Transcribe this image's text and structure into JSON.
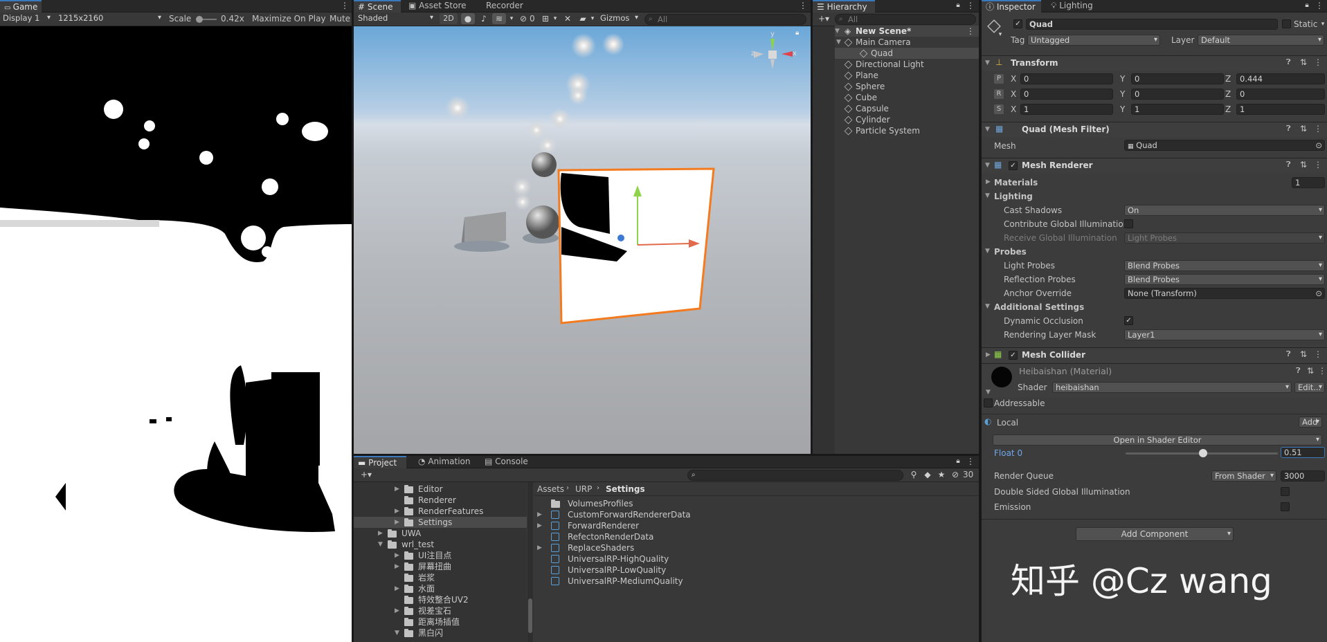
{
  "game": {
    "tab": "Game",
    "display": "Display 1",
    "resolution": "1215x2160",
    "scale_label": "Scale",
    "scale_value": "0.42x",
    "maximize": "Maximize On Play",
    "mute": "Mute A"
  },
  "scene": {
    "tabs": [
      "Scene",
      "Asset Store",
      "Recorder"
    ],
    "shading": "Shaded",
    "mode_2d": "2D",
    "hidden_count": "0",
    "gizmos": "Gizmos",
    "search_placeholder": "All",
    "gizmo_y": "y",
    "gizmo_x": "x",
    "gizmo_z": "z"
  },
  "hierarchy": {
    "tab": "Hierarchy",
    "search_placeholder": "All",
    "scene_name": "New Scene*",
    "items": [
      {
        "label": "Main Camera",
        "level": 1,
        "expanded": true
      },
      {
        "label": "Quad",
        "level": 2,
        "selected": true
      },
      {
        "label": "Directional Light",
        "level": 1
      },
      {
        "label": "Plane",
        "level": 1
      },
      {
        "label": "Sphere",
        "level": 1
      },
      {
        "label": "Cube",
        "level": 1
      },
      {
        "label": "Capsule",
        "level": 1
      },
      {
        "label": "Cylinder",
        "level": 1
      },
      {
        "label": "Particle System",
        "level": 1
      }
    ]
  },
  "inspector": {
    "tabs": [
      "Inspector",
      "Lighting"
    ],
    "object_name": "Quad",
    "static_label": "Static",
    "tag_label": "Tag",
    "tag_value": "Untagged",
    "layer_label": "Layer",
    "layer_value": "Default",
    "transform": {
      "title": "Transform",
      "rows": [
        {
          "key": "P",
          "x": "0",
          "y": "0",
          "z": "0.444"
        },
        {
          "key": "R",
          "x": "0",
          "y": "0",
          "z": "0"
        },
        {
          "key": "S",
          "x": "1",
          "y": "1",
          "z": "1"
        }
      ],
      "axis_x": "X",
      "axis_y": "Y",
      "axis_z": "Z"
    },
    "mesh_filter": {
      "title": "Quad (Mesh Filter)",
      "mesh_label": "Mesh",
      "mesh_value": "Quad"
    },
    "mesh_renderer": {
      "title": "Mesh Renderer",
      "materials_label": "Materials",
      "materials_count": "1",
      "lighting_label": "Lighting",
      "cast_shadows_label": "Cast Shadows",
      "cast_shadows_value": "On",
      "contribute_gi_label": "Contribute Global Illumination",
      "receive_gi_label": "Receive Global Illumination",
      "receive_gi_value": "Light Probes",
      "probes_label": "Probes",
      "light_probes_label": "Light Probes",
      "light_probes_value": "Blend Probes",
      "reflection_probes_label": "Reflection Probes",
      "reflection_probes_value": "Blend Probes",
      "anchor_override_label": "Anchor Override",
      "anchor_override_value": "None (Transform)",
      "additional_label": "Additional Settings",
      "dynamic_occlusion_label": "Dynamic Occlusion",
      "rendering_layer_label": "Rendering Layer Mask",
      "rendering_layer_value": "Layer1"
    },
    "mesh_collider": {
      "title": "Mesh Collider"
    },
    "material": {
      "title": "Heibaishan (Material)",
      "shader_label": "Shader",
      "shader_value": "heibaishan",
      "edit_label": "Edit...",
      "addressable_label": "Addressable",
      "local_label": "Local",
      "add_label": "Add",
      "open_editor_label": "Open in Shader Editor",
      "float_label": "Float 0",
      "float_value": "0.51",
      "float_fraction": 0.51,
      "render_queue_label": "Render Queue",
      "render_queue_mode": "From Shader",
      "render_queue_value": "3000",
      "double_sided_label": "Double Sided Global Illumination",
      "emission_label": "Emission"
    },
    "add_component": "Add Component",
    "watermark": "知乎 @Cz wang"
  },
  "project": {
    "tabs": [
      "Project",
      "Animation",
      "Console"
    ],
    "hidden_count": "30",
    "tree": [
      {
        "label": "Editor",
        "indent": 4,
        "arrow": "right"
      },
      {
        "label": "Renderer",
        "indent": 4
      },
      {
        "label": "RenderFeatures",
        "indent": 4,
        "arrow": "right"
      },
      {
        "label": "Settings",
        "indent": 4,
        "arrow": "right",
        "selected": true
      },
      {
        "label": "UWA",
        "indent": 2,
        "arrow": "right"
      },
      {
        "label": "wrl_test",
        "indent": 2,
        "arrow": "down"
      },
      {
        "label": "UI注目点",
        "indent": 3,
        "arrow": "right"
      },
      {
        "label": "屏幕扭曲",
        "indent": 3,
        "arrow": "right"
      },
      {
        "label": "岩浆",
        "indent": 3
      },
      {
        "label": "水面",
        "indent": 3,
        "arrow": "right"
      },
      {
        "label": "特效整合UV2",
        "indent": 3
      },
      {
        "label": "视差宝石",
        "indent": 3,
        "arrow": "right"
      },
      {
        "label": "距离场插值",
        "indent": 3
      },
      {
        "label": "黑白闪",
        "indent": 3,
        "arrow": "down"
      }
    ],
    "breadcrumb": [
      "Assets",
      "URP",
      "Settings"
    ],
    "files": [
      {
        "label": "VolumesProfiles",
        "type": "folder"
      },
      {
        "label": "CustomForwardRendererData",
        "type": "asset",
        "arrow": true
      },
      {
        "label": "ForwardRenderer",
        "type": "asset",
        "arrow": true
      },
      {
        "label": "RefectonRenderData",
        "type": "asset"
      },
      {
        "label": "ReplaceShaders",
        "type": "asset",
        "arrow": true
      },
      {
        "label": "UniversalRP-HighQuality",
        "type": "asset"
      },
      {
        "label": "UniversalRP-LowQuality",
        "type": "asset"
      },
      {
        "label": "UniversalRP-MediumQuality",
        "type": "asset"
      }
    ]
  },
  "colors": {
    "accent": "#3a79bb",
    "selection_orange": "#f47a1f",
    "panel": "#383838"
  }
}
